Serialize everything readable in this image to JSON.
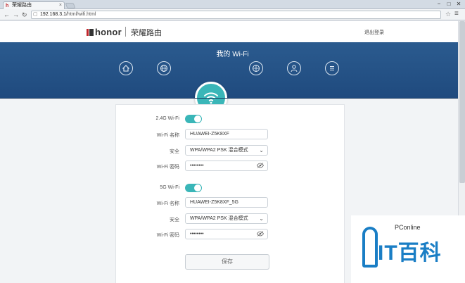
{
  "browser": {
    "tab_title": "荣耀路由",
    "tab_favicon": "h",
    "tab_close": "×",
    "url_host": "192.168.3.1",
    "url_path": "/html/wifi.html",
    "window_minimize": "−",
    "window_maximize": "□",
    "window_close": "✕"
  },
  "header": {
    "logo_text": "honor",
    "product_name": "荣耀路由",
    "logout_label": "退出登录"
  },
  "banner": {
    "title": "我的 Wi-Fi",
    "nav_icons": [
      "home-icon",
      "globe-icon",
      "wifi-icon",
      "devices-globe-icon",
      "user-icon",
      "menu-icon"
    ]
  },
  "wifi_24": {
    "toggle_label": "2.4G Wi-Fi",
    "enabled": true,
    "name_label": "Wi-Fi 名称",
    "name_value": "HUAWEI-Z5K8XF",
    "security_label": "安全",
    "security_value": "WPA/WPA2 PSK 混合模式",
    "password_label": "Wi-Fi 密码",
    "password_value": "••••••••"
  },
  "wifi_5": {
    "toggle_label": "5G Wi-Fi",
    "enabled": true,
    "name_label": "Wi-Fi 名称",
    "name_value": "HUAWEI-Z5K8XF_5G",
    "security_label": "安全",
    "security_value": "WPA/WPA2 PSK 混合模式",
    "password_label": "Wi-Fi 密码",
    "password_value": "••••••••"
  },
  "save_label": "保存",
  "watermark": {
    "brand": "PConline",
    "big_text": "IT百科"
  },
  "colors": {
    "accent": "#3ab6b8",
    "banner": "#234f84",
    "watermark_blue": "#1a7ec5"
  }
}
